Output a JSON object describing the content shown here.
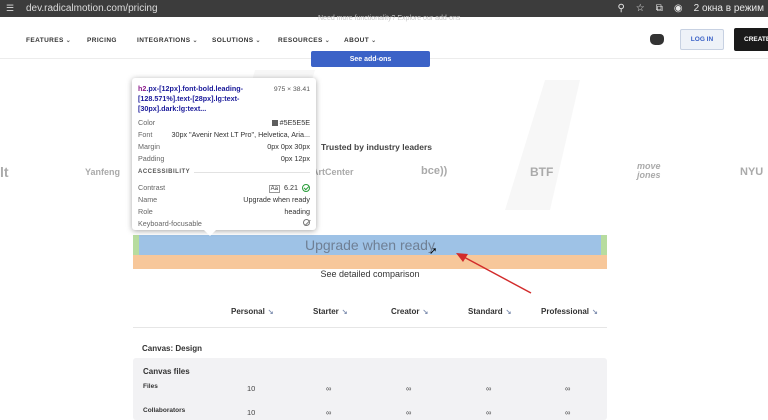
{
  "browser": {
    "url": "dev.radicalmotion.com/pricing",
    "incognito_label": "2 окна в режим"
  },
  "nav": {
    "items": [
      {
        "label": "FEATURES",
        "dropdown": true
      },
      {
        "label": "PRICING",
        "dropdown": false
      },
      {
        "label": "INTEGRATIONS",
        "dropdown": true
      },
      {
        "label": "SOLUTIONS",
        "dropdown": true
      },
      {
        "label": "RESOURCES",
        "dropdown": true
      },
      {
        "label": "ABOUT",
        "dropdown": true
      }
    ],
    "login_label": "LOG IN",
    "create_label": "CREATE"
  },
  "hero": {
    "faded_text": "Need more functionality? Explore our add-ons",
    "addons_button": "See add-ons"
  },
  "trusted": {
    "title": "Trusted by industry leaders",
    "logos": [
      "lt",
      "Yanfeng",
      "ArtCenter",
      "bce))",
      "BTF",
      "move jones",
      "NYU"
    ]
  },
  "inspector": {
    "selector_tag": "h2",
    "selector_rest": ".px-[12px].font-bold.leading-[128.571%].text-[28px].lg:text-[30px].dark:lg:text...",
    "dimensions": "975 × 38.41",
    "color_label": "Color",
    "color_value": "#5E5E5E",
    "font_label": "Font",
    "font_value": "30px \"Avenir Next LT Pro\", Helvetica, Aria...",
    "margin_label": "Margin",
    "margin_value": "0px 0px 30px",
    "padding_label": "Padding",
    "padding_value": "0px 12px",
    "accessibility_label": "ACCESSIBILITY",
    "contrast_label": "Contrast",
    "contrast_aa": "Aa",
    "contrast_value": "6.21",
    "name_label": "Name",
    "name_value": "Upgrade when ready",
    "role_label": "Role",
    "role_value": "heading",
    "keyboard_label": "Keyboard-focusable"
  },
  "section": {
    "heading": "Upgrade when ready",
    "compare_link": "See detailed comparison"
  },
  "table": {
    "plans": [
      "Personal",
      "Starter",
      "Creator",
      "Standard",
      "Professional"
    ],
    "sort_glyph": "↘",
    "group_title": "Canvas: Design",
    "subgroup_title": "Canvas files",
    "rows": [
      {
        "label": "Files",
        "values": [
          "10",
          "∞",
          "∞",
          "∞",
          "∞"
        ]
      },
      {
        "label": "Collaborators",
        "values": [
          "10",
          "∞",
          "∞",
          "∞",
          "∞"
        ]
      }
    ]
  },
  "colors": {
    "accent": "#3b62c7",
    "highlight_content": "#9ec2e6",
    "highlight_margin": "#f7c79a",
    "highlight_padding": "#b7dc9f",
    "annotation_arrow": "#d22b2b"
  }
}
